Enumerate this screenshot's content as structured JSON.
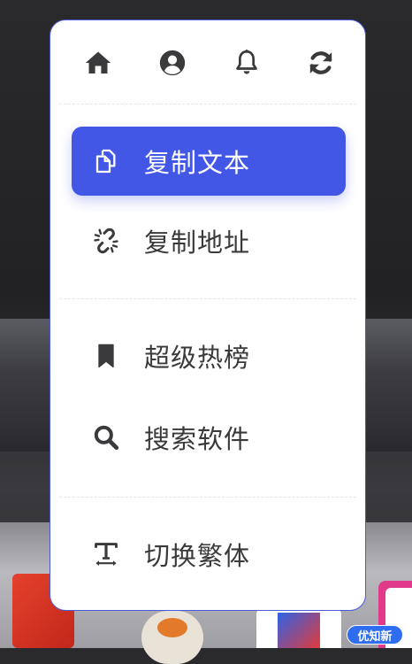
{
  "menu": {
    "top_icons": [
      {
        "icon": "home-icon"
      },
      {
        "icon": "user-icon"
      },
      {
        "icon": "bell-icon"
      },
      {
        "icon": "refresh-icon"
      }
    ],
    "items": [
      {
        "label": "复制文本",
        "icon": "copy-icon",
        "active": true
      },
      {
        "label": "复制地址",
        "icon": "unlink-icon",
        "active": false
      },
      {
        "label": "超级热榜",
        "icon": "bookmark-icon",
        "active": false
      },
      {
        "label": "搜索软件",
        "icon": "search-icon",
        "active": false
      },
      {
        "label": "切换繁体",
        "icon": "text-width-icon",
        "active": false
      }
    ]
  },
  "watermark": {
    "text": "优知新"
  },
  "colors": {
    "accent": "#4357e6",
    "menu_border": "#4a5bd8",
    "icon": "#3a3a3c",
    "text": "#3a3a3c"
  }
}
